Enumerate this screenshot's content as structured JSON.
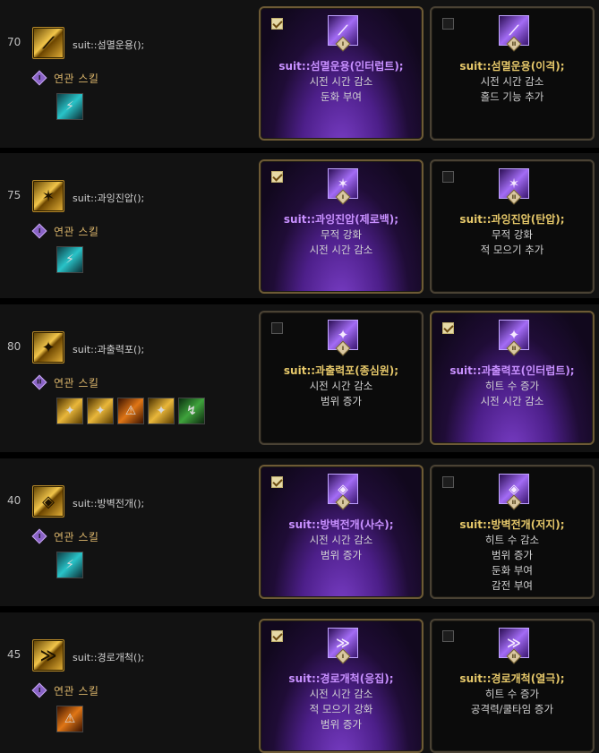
{
  "rows": [
    {
      "level": "70",
      "skill_name": "suit::섬멸운용();",
      "related_label": "연관 스킬",
      "related_numeral": "I",
      "related_icons": [
        "cyan"
      ],
      "cards": [
        {
          "checked": true,
          "title": "suit::섬멸운용(인터럽트);",
          "lines": [
            "시전 시간 감소",
            "둔화 부여"
          ],
          "numeral": "I"
        },
        {
          "checked": false,
          "title": "suit::섬멸운용(이격);",
          "lines": [
            "시전 시간 감소",
            "홀드 기능 추가"
          ],
          "numeral": "II"
        }
      ]
    },
    {
      "level": "75",
      "skill_name": "suit::과잉진압();",
      "related_label": "연관 스킬",
      "related_numeral": "I",
      "related_icons": [
        "cyan"
      ],
      "cards": [
        {
          "checked": true,
          "title": "suit::과잉진압(제로백);",
          "lines": [
            "무적 강화",
            "시전 시간 감소"
          ],
          "numeral": "I"
        },
        {
          "checked": false,
          "title": "suit::과잉진압(탄압);",
          "lines": [
            "무적 강화",
            "적 모으기 추가"
          ],
          "numeral": "II"
        }
      ]
    },
    {
      "level": "80",
      "skill_name": "suit::과출력포();",
      "related_label": "연관 스킬",
      "related_numeral": "II",
      "related_icons": [
        "gold",
        "gold",
        "orange",
        "gold",
        "green"
      ],
      "cards": [
        {
          "checked": false,
          "title": "suit::과출력포(종심원);",
          "lines": [
            "시전 시간 감소",
            "범위 증가"
          ],
          "numeral": "I"
        },
        {
          "checked": true,
          "title": "suit::과출력포(인터럽트);",
          "lines": [
            "히트 수 증가",
            "시전 시간 감소"
          ],
          "numeral": "II"
        }
      ]
    },
    {
      "level": "40",
      "skill_name": "suit::방벽전개();",
      "related_label": "연관 스킬",
      "related_numeral": "I",
      "related_icons": [
        "cyan"
      ],
      "cards": [
        {
          "checked": true,
          "title": "suit::방벽전개(사수);",
          "lines": [
            "시전 시간 감소",
            "범위 증가"
          ],
          "numeral": "I"
        },
        {
          "checked": false,
          "title": "suit::방벽전개(저지);",
          "lines": [
            "히트 수 감소",
            "범위 증가",
            "둔화 부여",
            "감전 부여"
          ],
          "numeral": "II"
        }
      ]
    },
    {
      "level": "45",
      "skill_name": "suit::경로개척();",
      "related_label": "연관 스킬",
      "related_numeral": "I",
      "related_icons": [
        "orange"
      ],
      "cards": [
        {
          "checked": true,
          "title": "suit::경로개척(응집);",
          "lines": [
            "시전 시간 감소",
            "적 모으기 강화",
            "범위 증가"
          ],
          "numeral": "I"
        },
        {
          "checked": false,
          "title": "suit::경로개척(열극);",
          "lines": [
            "히트 수 증가",
            "공격력/쿨타임 증가"
          ],
          "numeral": "II"
        }
      ]
    }
  ],
  "colors": {
    "selected_title": "#c890ff",
    "unselected_title": "#e6c86a",
    "related_label": "#d8b36a",
    "card_border": "#4a4234"
  }
}
